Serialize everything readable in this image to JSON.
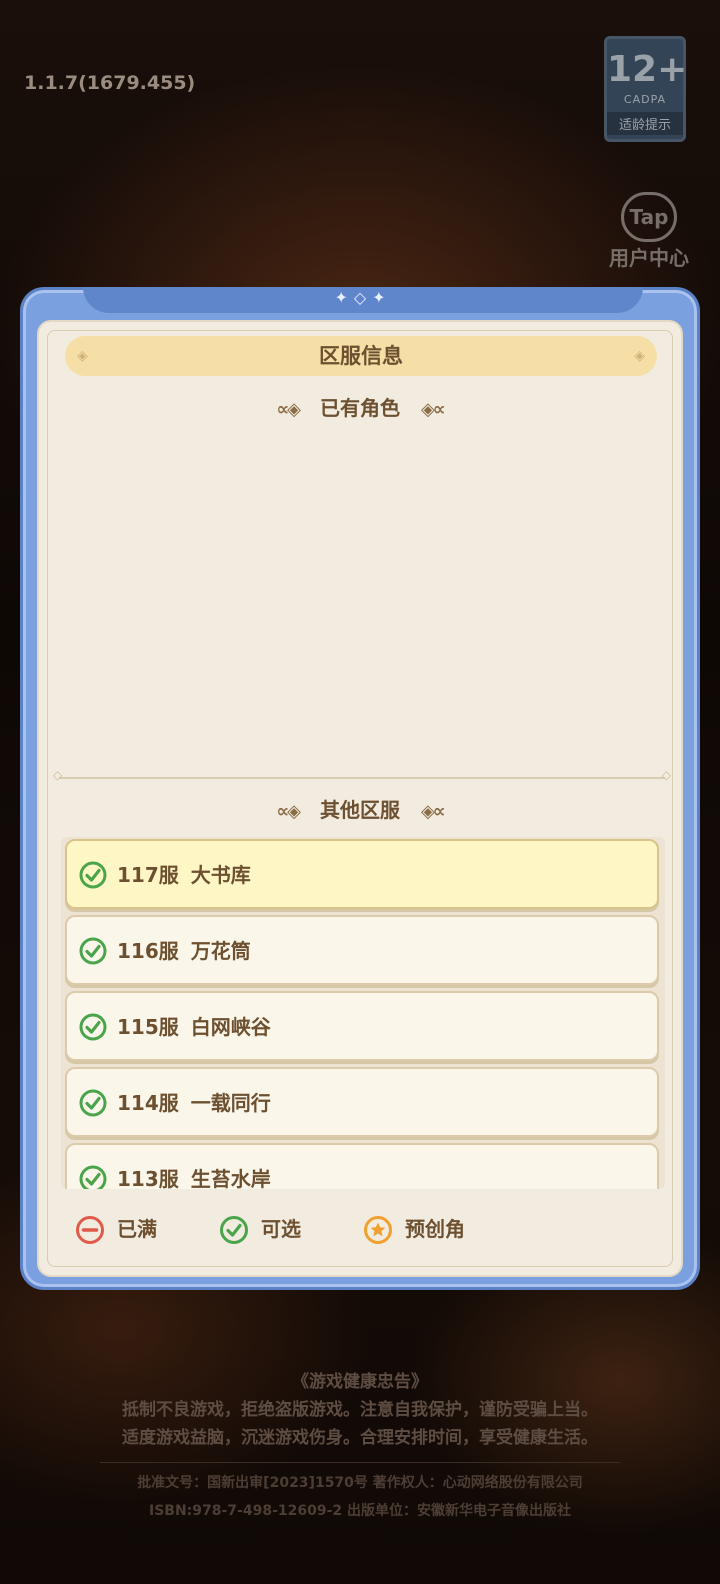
{
  "version": "1.1.7(1679.455)",
  "age_badge": {
    "rating": "12+",
    "org": "CADPA",
    "tip": "适龄提示"
  },
  "tap": {
    "logo": "Tap",
    "label": "用户中心"
  },
  "dialog": {
    "title": "区服信息",
    "existing_section": "已有角色",
    "other_section": "其他区服",
    "servers": [
      {
        "number": "117服",
        "name": "大书库",
        "status": "可选",
        "selected": true
      },
      {
        "number": "116服",
        "name": "万花筒",
        "status": "可选",
        "selected": false
      },
      {
        "number": "115服",
        "name": "白网峡谷",
        "status": "可选",
        "selected": false
      },
      {
        "number": "114服",
        "name": "一载同行",
        "status": "可选",
        "selected": false
      },
      {
        "number": "113服",
        "name": "生苔水岸",
        "status": "可选",
        "selected": false
      }
    ],
    "legend": {
      "full": "已满",
      "available": "可选",
      "pre_create": "预创角"
    }
  },
  "advisory": {
    "title": "《游戏健康忠告》",
    "line1": "抵制不良游戏，拒绝盗版游戏。注意自我保护，谨防受骗上当。",
    "line2": "适度游戏益脑，沉迷游戏伤身。合理安排时间，享受健康生活。",
    "approval": "批准文号：国新出审[2023]1570号    著作权人：心动网络股份有限公司",
    "isbn": "ISBN:978-7-498-12609-2        出版单位：安徽新华电子音像出版社"
  },
  "colors": {
    "available": "#4aa44a",
    "full": "#e05a4a",
    "pre_create": "#f0a030",
    "accent": "#7aa0e0"
  }
}
